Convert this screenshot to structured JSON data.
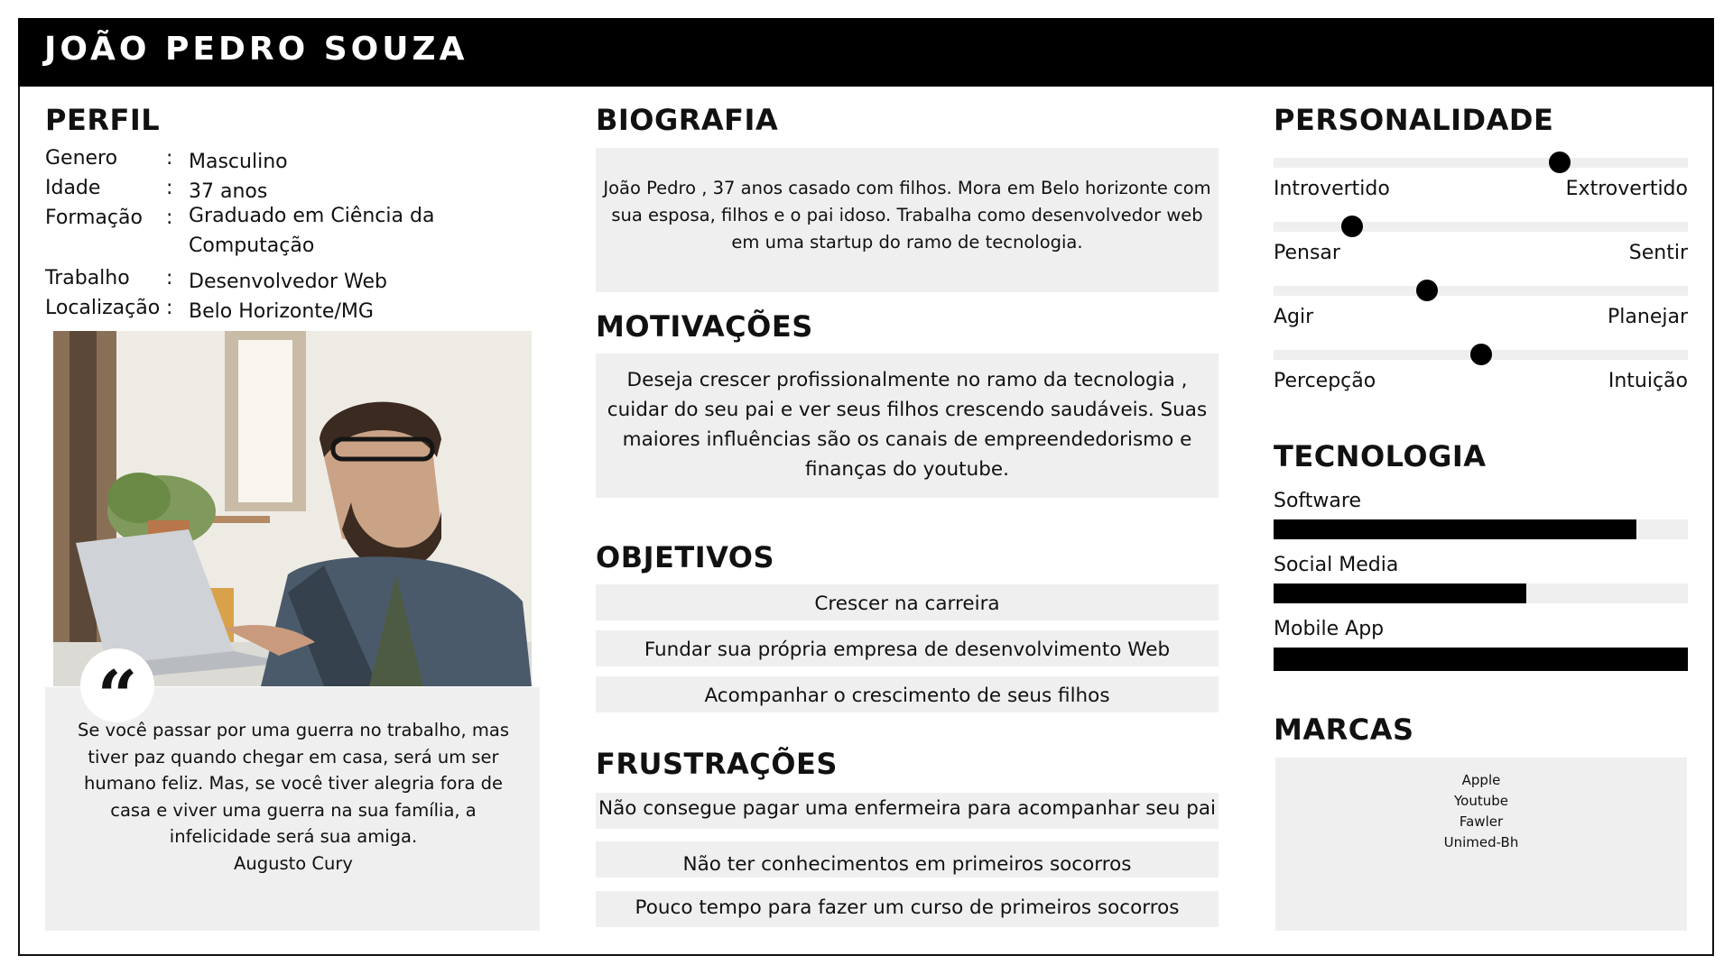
{
  "header": {
    "name": "JOÃO PEDRO SOUZA"
  },
  "profile": {
    "title": "PERFIL",
    "rows": [
      {
        "key": "Genero",
        "sep": ":",
        "value": "Masculino"
      },
      {
        "key": "Idade",
        "sep": ":",
        "value": "37 anos"
      },
      {
        "key": "Formação",
        "sep": ":",
        "value": "Graduado em Ciência da Computação"
      },
      {
        "key": "Trabalho",
        "sep": ":",
        "value": "Desenvolvedor Web"
      },
      {
        "key": "Localização",
        "sep": ":",
        "value": "Belo Horizonte/MG"
      }
    ]
  },
  "quote": {
    "mark": "“",
    "text": "Se você passar por uma guerra no trabalho, mas tiver paz quando chegar em casa, será um ser humano feliz. Mas, se você tiver alegria fora de casa e viver uma guerra na sua família, a infelicidade será sua amiga.",
    "author": "Augusto Cury"
  },
  "biography": {
    "title": "BIOGRAFIA",
    "text": "João Pedro , 37 anos casado com filhos. Mora em Belo horizonte com sua esposa, filhos e o pai idoso. Trabalha como desenvolvedor web em uma  startup do ramo de tecnologia."
  },
  "motivations": {
    "title": "MOTIVAÇÕES",
    "text": "Deseja crescer profissionalmente  no ramo da tecnologia , cuidar do seu pai e ver seus filhos crescendo saudáveis. Suas maiores influências são os canais de empreendedorismo e finanças do youtube."
  },
  "goals": {
    "title": "OBJETIVOS",
    "items": [
      "Crescer na carreira",
      "Fundar sua própria empresa de desenvolvimento Web",
      "Acompanhar o crescimento de seus filhos"
    ]
  },
  "frustrations": {
    "title": "FRUSTRAÇÕES",
    "items": [
      "Não consegue pagar uma enfermeira para acompanhar seu pai",
      "Não ter conhecimentos em primeiros socorros",
      "Pouco tempo para fazer um curso de primeiros socorros"
    ]
  },
  "personality": {
    "title": "PERSONALIDADE",
    "traits": [
      {
        "left": "Introvertido",
        "right": "Extrovertido",
        "level": 0.69
      },
      {
        "left": "Pensar",
        "right": "Sentir",
        "level": 0.19
      },
      {
        "left": "Agir",
        "right": "Planejar",
        "level": 0.37
      },
      {
        "left": "Percepção",
        "right": "Intuição",
        "level": 0.5
      }
    ]
  },
  "technology": {
    "title": "TECNOLOGIA",
    "items": [
      {
        "label": "Software",
        "level": 0.875
      },
      {
        "label": "Social Media",
        "level": 0.61
      },
      {
        "label": "Mobile App",
        "level": 1.0
      }
    ]
  },
  "brands": {
    "title": "MARCAS",
    "items": [
      "Apple",
      "Youtube",
      "Fawler",
      "Unimed-Bh"
    ]
  },
  "colors": {
    "header_bg": "#000000",
    "box_bg": "#efefef",
    "accent": "#000000"
  }
}
